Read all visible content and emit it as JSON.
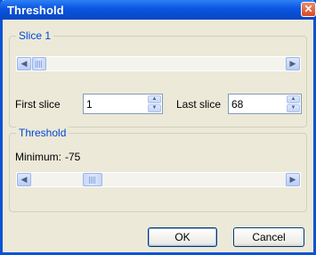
{
  "window": {
    "title": "Threshold",
    "close_glyph": "✕"
  },
  "slice_group": {
    "legend": "Slice 1",
    "scrollbar": {
      "left_glyph": "◀",
      "right_glyph": "▶",
      "position": 0.0
    },
    "first_slice": {
      "label": "First slice",
      "value": "1",
      "up_glyph": "▲",
      "down_glyph": "▼"
    },
    "last_slice": {
      "label": "Last slice",
      "value": "68",
      "up_glyph": "▲",
      "down_glyph": "▼"
    }
  },
  "threshold_group": {
    "legend": "Threshold",
    "minimum_label": "Minimum:",
    "minimum_value": "-75",
    "scrollbar": {
      "left_glyph": "◀",
      "right_glyph": "▶",
      "position": 0.3
    }
  },
  "buttons": {
    "ok": "OK",
    "cancel": "Cancel"
  }
}
